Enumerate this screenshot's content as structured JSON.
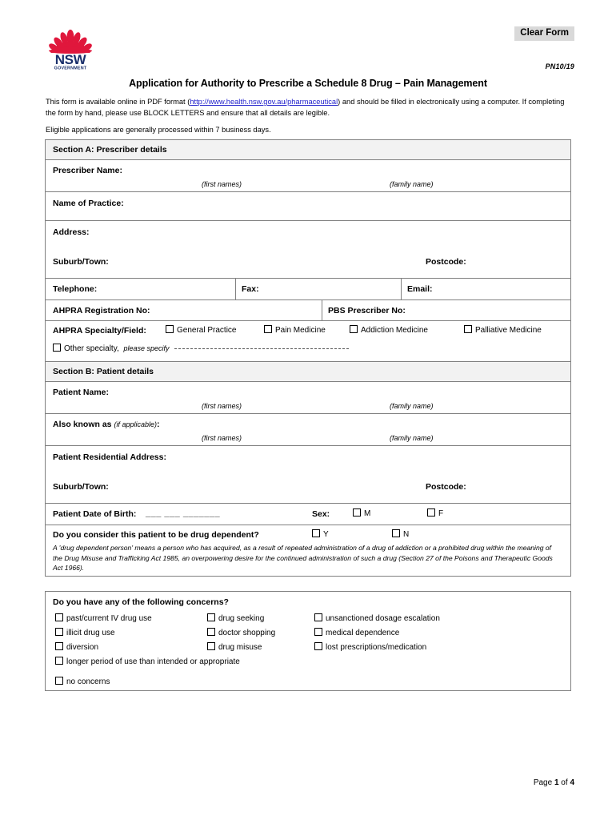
{
  "header": {
    "clear_form_label": "Clear Form",
    "form_code": "PN10/19",
    "logo_text": "NSW",
    "logo_subtext": "GOVERNMENT",
    "title": "Application for Authority to Prescribe a Schedule 8 Drug – Pain Management",
    "intro_before_link": "This form is available online in PDF format (",
    "intro_link": "http://www.health.nsw.gov.au/pharmaceutical",
    "intro_after_link": ") and should be filled in electronically using a computer.  If completing the form by hand, please use BLOCK LETTERS and ensure that all details are legible.",
    "intro_line2": "Eligible applications are generally processed within 7 business days."
  },
  "section_a": {
    "heading": "Section A:  Prescriber details",
    "prescriber_name_label": "Prescriber Name:",
    "hint_first": "(first names)",
    "hint_family": "(family name)",
    "practice_name_label": "Name of Practice:",
    "address_label": "Address:",
    "suburb_label": "Suburb/Town:",
    "postcode_label": "Postcode:",
    "telephone_label": "Telephone:",
    "fax_label": "Fax:",
    "email_label": "Email:",
    "ahpra_reg_label": "AHPRA Registration No:",
    "pbs_label": "PBS Prescriber No:",
    "specialty_label": "AHPRA Specialty/Field:",
    "specialty_options": [
      "General Practice",
      "Pain Medicine",
      "Addiction Medicine",
      "Palliative Medicine"
    ],
    "other_specialty_label": "Other specialty,",
    "other_specialty_hint": "please specify"
  },
  "section_b": {
    "heading": "Section B:  Patient details",
    "patient_name_label": "Patient Name:",
    "hint_first": "(first names)",
    "hint_family": "(family name)",
    "aka_label": "Also known as",
    "aka_hint": "(if applicable)",
    "aka_colon": ":",
    "residential_address_label": "Patient Residential Address:",
    "suburb_label": "Suburb/Town:",
    "postcode_label": "Postcode:",
    "dob_label": "Patient Date of Birth:",
    "dob_blanks": "___  ___  _______",
    "sex_label": "Sex:",
    "sex_male": "M",
    "sex_female": "F",
    "dependent_question": "Do you consider this patient to be drug dependent?",
    "dependent_yes": "Y",
    "dependent_no": "N",
    "dependent_definition": "A 'drug dependent person' means a person who has acquired, as a result of repeated administration of a drug of addiction or a prohibited drug within the meaning of the Drug Misuse and Trafficking Act 1985, an overpowering desire for the continued administration of such a drug (Section 27 of the Poisons and Therapeutic Goods Act 1966)."
  },
  "concerns": {
    "question": "Do you have any of the following concerns?",
    "column1": [
      "past/current IV drug use",
      "illicit drug use",
      "diversion"
    ],
    "column2": [
      "drug seeking",
      "doctor shopping",
      "drug misuse"
    ],
    "column3": [
      "unsanctioned dosage escalation",
      "medical dependence",
      "lost prescriptions/medication"
    ],
    "wide_option": "longer period of use than intended or appropriate",
    "no_concerns": "no concerns"
  },
  "footer": {
    "page_prefix": "Page ",
    "page_current": "1",
    "page_mid": " of ",
    "page_total": "4"
  },
  "colors": {
    "logo_red": "#e0173c",
    "logo_blue": "#1a2f6b",
    "link": "#2222cc",
    "section_bg": "#f2f2f2",
    "border": "#808080"
  }
}
